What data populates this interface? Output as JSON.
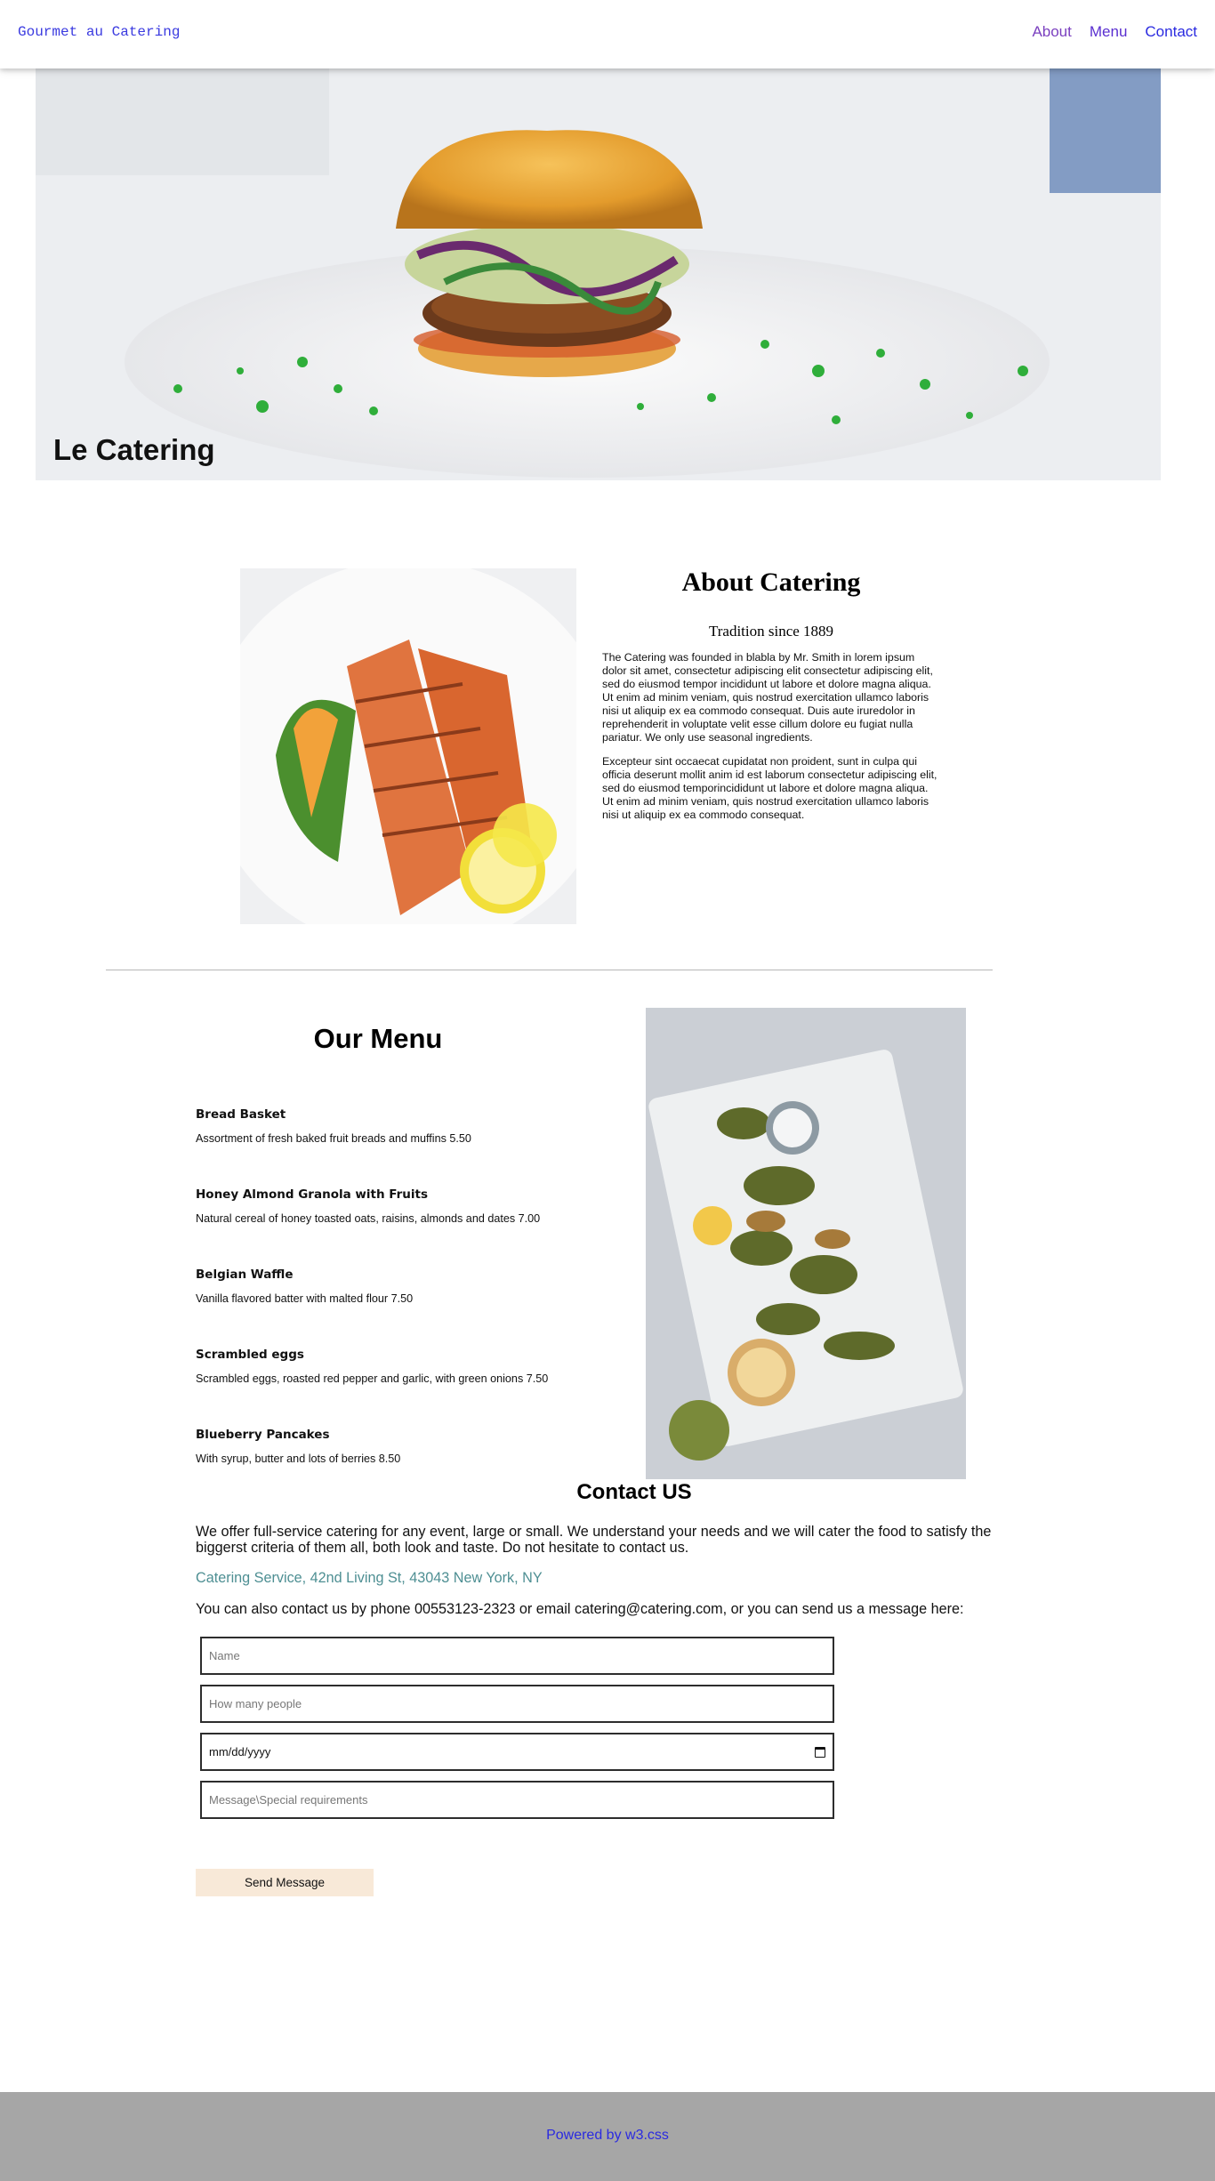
{
  "nav": {
    "brand": "Gourmet au Catering",
    "links": [
      "About",
      "Menu",
      "Contact"
    ]
  },
  "hero": {
    "title": "Le Catering"
  },
  "about": {
    "title": "About Catering",
    "subtitle": "Tradition since 1889",
    "paragraphs": [
      "The Catering was founded in blabla by Mr. Smith in lorem ipsum dolor sit amet, consectetur adipiscing elit consectetur adipiscing elit, sed do eiusmod tempor incididunt ut labore et dolore magna aliqua. Ut enim ad minim veniam, quis nostrud exercitation ullamco laboris nisi ut aliquip ex ea commodo consequat. Duis aute iruredolor in reprehenderit in voluptate velit esse cillum dolore eu fugiat nulla pariatur. We only use seasonal ingredients.",
      "Excepteur sint occaecat cupidatat non proident, sunt in culpa qui officia deserunt mollit anim id est laborum consectetur adipiscing elit, sed do eiusmod temporincididunt ut labore et dolore magna aliqua. Ut enim ad minim veniam, quis nostrud exercitation ullamco laboris nisi ut aliquip ex ea commodo consequat."
    ]
  },
  "menu": {
    "title": "Our Menu",
    "items": [
      {
        "name": "Bread Basket",
        "desc": "Assortment of fresh baked fruit breads and muffins 5.50"
      },
      {
        "name": "Honey Almond Granola with Fruits",
        "desc": "Natural cereal of honey toasted oats, raisins, almonds and dates 7.00"
      },
      {
        "name": "Belgian Waffle",
        "desc": "Vanilla flavored batter with malted flour 7.50"
      },
      {
        "name": "Scrambled eggs",
        "desc": "Scrambled eggs, roasted red pepper and garlic, with green onions 7.50"
      },
      {
        "name": "Blueberry Pancakes",
        "desc": "With syrup, butter and lots of berries 8.50"
      }
    ]
  },
  "contact": {
    "title": "Contact US",
    "intro": "We offer full-service catering for any event, large or small. We understand your needs and we will cater the food to satisfy the biggerst criteria of them all, both look and taste. Do not hesitate to contact us.",
    "address": "Catering Service, 42nd Living St, 43043 New York, NY",
    "phone_line": "You can also contact us by phone 00553123-2323 or email catering@catering.com, or you can send us a message here:",
    "fields": {
      "name_placeholder": "Name",
      "people_placeholder": "How many people",
      "date_value": "mm/dd/yyyy",
      "message_placeholder": "Message\\Special requirements"
    },
    "send_label": "Send Message"
  },
  "footer": {
    "prefix": "Powered by ",
    "link": "w3.css"
  }
}
